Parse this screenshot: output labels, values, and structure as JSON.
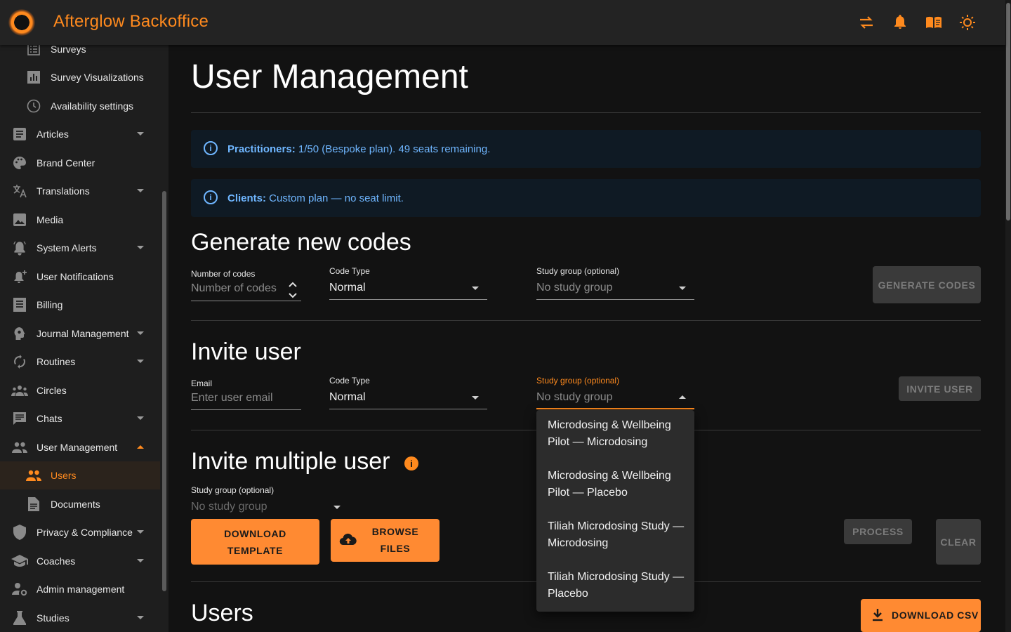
{
  "app": {
    "title": "Afterglow Backoffice"
  },
  "topbar": {
    "icons": [
      "swap-icon",
      "bell-icon",
      "book-icon",
      "sun-icon"
    ]
  },
  "sidebar": {
    "items": [
      {
        "label": "Surveys",
        "icon": "list-icon"
      },
      {
        "label": "Survey Visualizations",
        "icon": "bar-chart-icon"
      },
      {
        "label": "Availability settings",
        "icon": "clock-icon"
      },
      {
        "label": "Articles",
        "icon": "article-icon"
      },
      {
        "label": "Brand Center",
        "icon": "palette-icon"
      },
      {
        "label": "Translations",
        "icon": "translate-icon"
      },
      {
        "label": "Media",
        "icon": "image-icon"
      },
      {
        "label": "System Alerts",
        "icon": "alarm-icon"
      },
      {
        "label": "User Notifications",
        "icon": "notification-add-icon"
      },
      {
        "label": "Billing",
        "icon": "receipt-icon"
      },
      {
        "label": "Journal Management",
        "icon": "psychology-icon"
      },
      {
        "label": "Routines",
        "icon": "sync-icon"
      },
      {
        "label": "Circles",
        "icon": "groups-icon"
      },
      {
        "label": "Chats",
        "icon": "chat-icon"
      },
      {
        "label": "User Management",
        "icon": "people-icon"
      },
      {
        "label": "Users",
        "icon": "people-icon"
      },
      {
        "label": "Documents",
        "icon": "document-icon"
      },
      {
        "label": "Privacy & Compliance",
        "icon": "shield-icon"
      },
      {
        "label": "Coaches",
        "icon": "school-icon"
      },
      {
        "label": "Admin management",
        "icon": "manage-accounts-icon"
      },
      {
        "label": "Studies",
        "icon": "flask-icon"
      }
    ]
  },
  "page": {
    "title": "User Management"
  },
  "alerts": {
    "practitioners": {
      "bold": "Practitioners:",
      "text": " 1/50 (Bespoke plan). 49 seats remaining."
    },
    "clients": {
      "bold": "Clients:",
      "text": " Custom plan — no seat limit."
    }
  },
  "generate": {
    "title": "Generate new codes",
    "num_label": "Number of codes",
    "num_placeholder": "Number of codes",
    "type_label": "Code Type",
    "type_value": "Normal",
    "group_label": "Study group (optional)",
    "group_value": "No study group",
    "button": "GENERATE CODES"
  },
  "invite": {
    "title": "Invite user",
    "email_label": "Email",
    "email_placeholder": "Enter user email",
    "type_label": "Code Type",
    "type_value": "Normal",
    "group_label": "Study group (optional)",
    "group_value": "No study group",
    "button": "INVITE USER",
    "focus_color": "#ff8a1e"
  },
  "dropdown": {
    "options": [
      "Microdosing & Wellbeing Pilot — Microdosing",
      "Microdosing & Wellbeing Pilot — Placebo",
      "Tiliah Microdosing Study — Microdosing",
      "Tiliah Microdosing Study — Placebo"
    ]
  },
  "multi": {
    "title": "Invite multiple user",
    "group_label": "Study group (optional)",
    "group_value": "No study group",
    "download_template": "DOWNLOAD TEMPLATE",
    "browse_files": "BROWSE FILES",
    "process": "PROCESS",
    "clear": "CLEAR"
  },
  "users": {
    "title": "Users",
    "download_csv": "DOWNLOAD CSV"
  },
  "colors": {
    "accent": "#ff8a32",
    "info": "#6fb6ff",
    "bg": "#121212",
    "sidebar": "#1e1e1e"
  }
}
